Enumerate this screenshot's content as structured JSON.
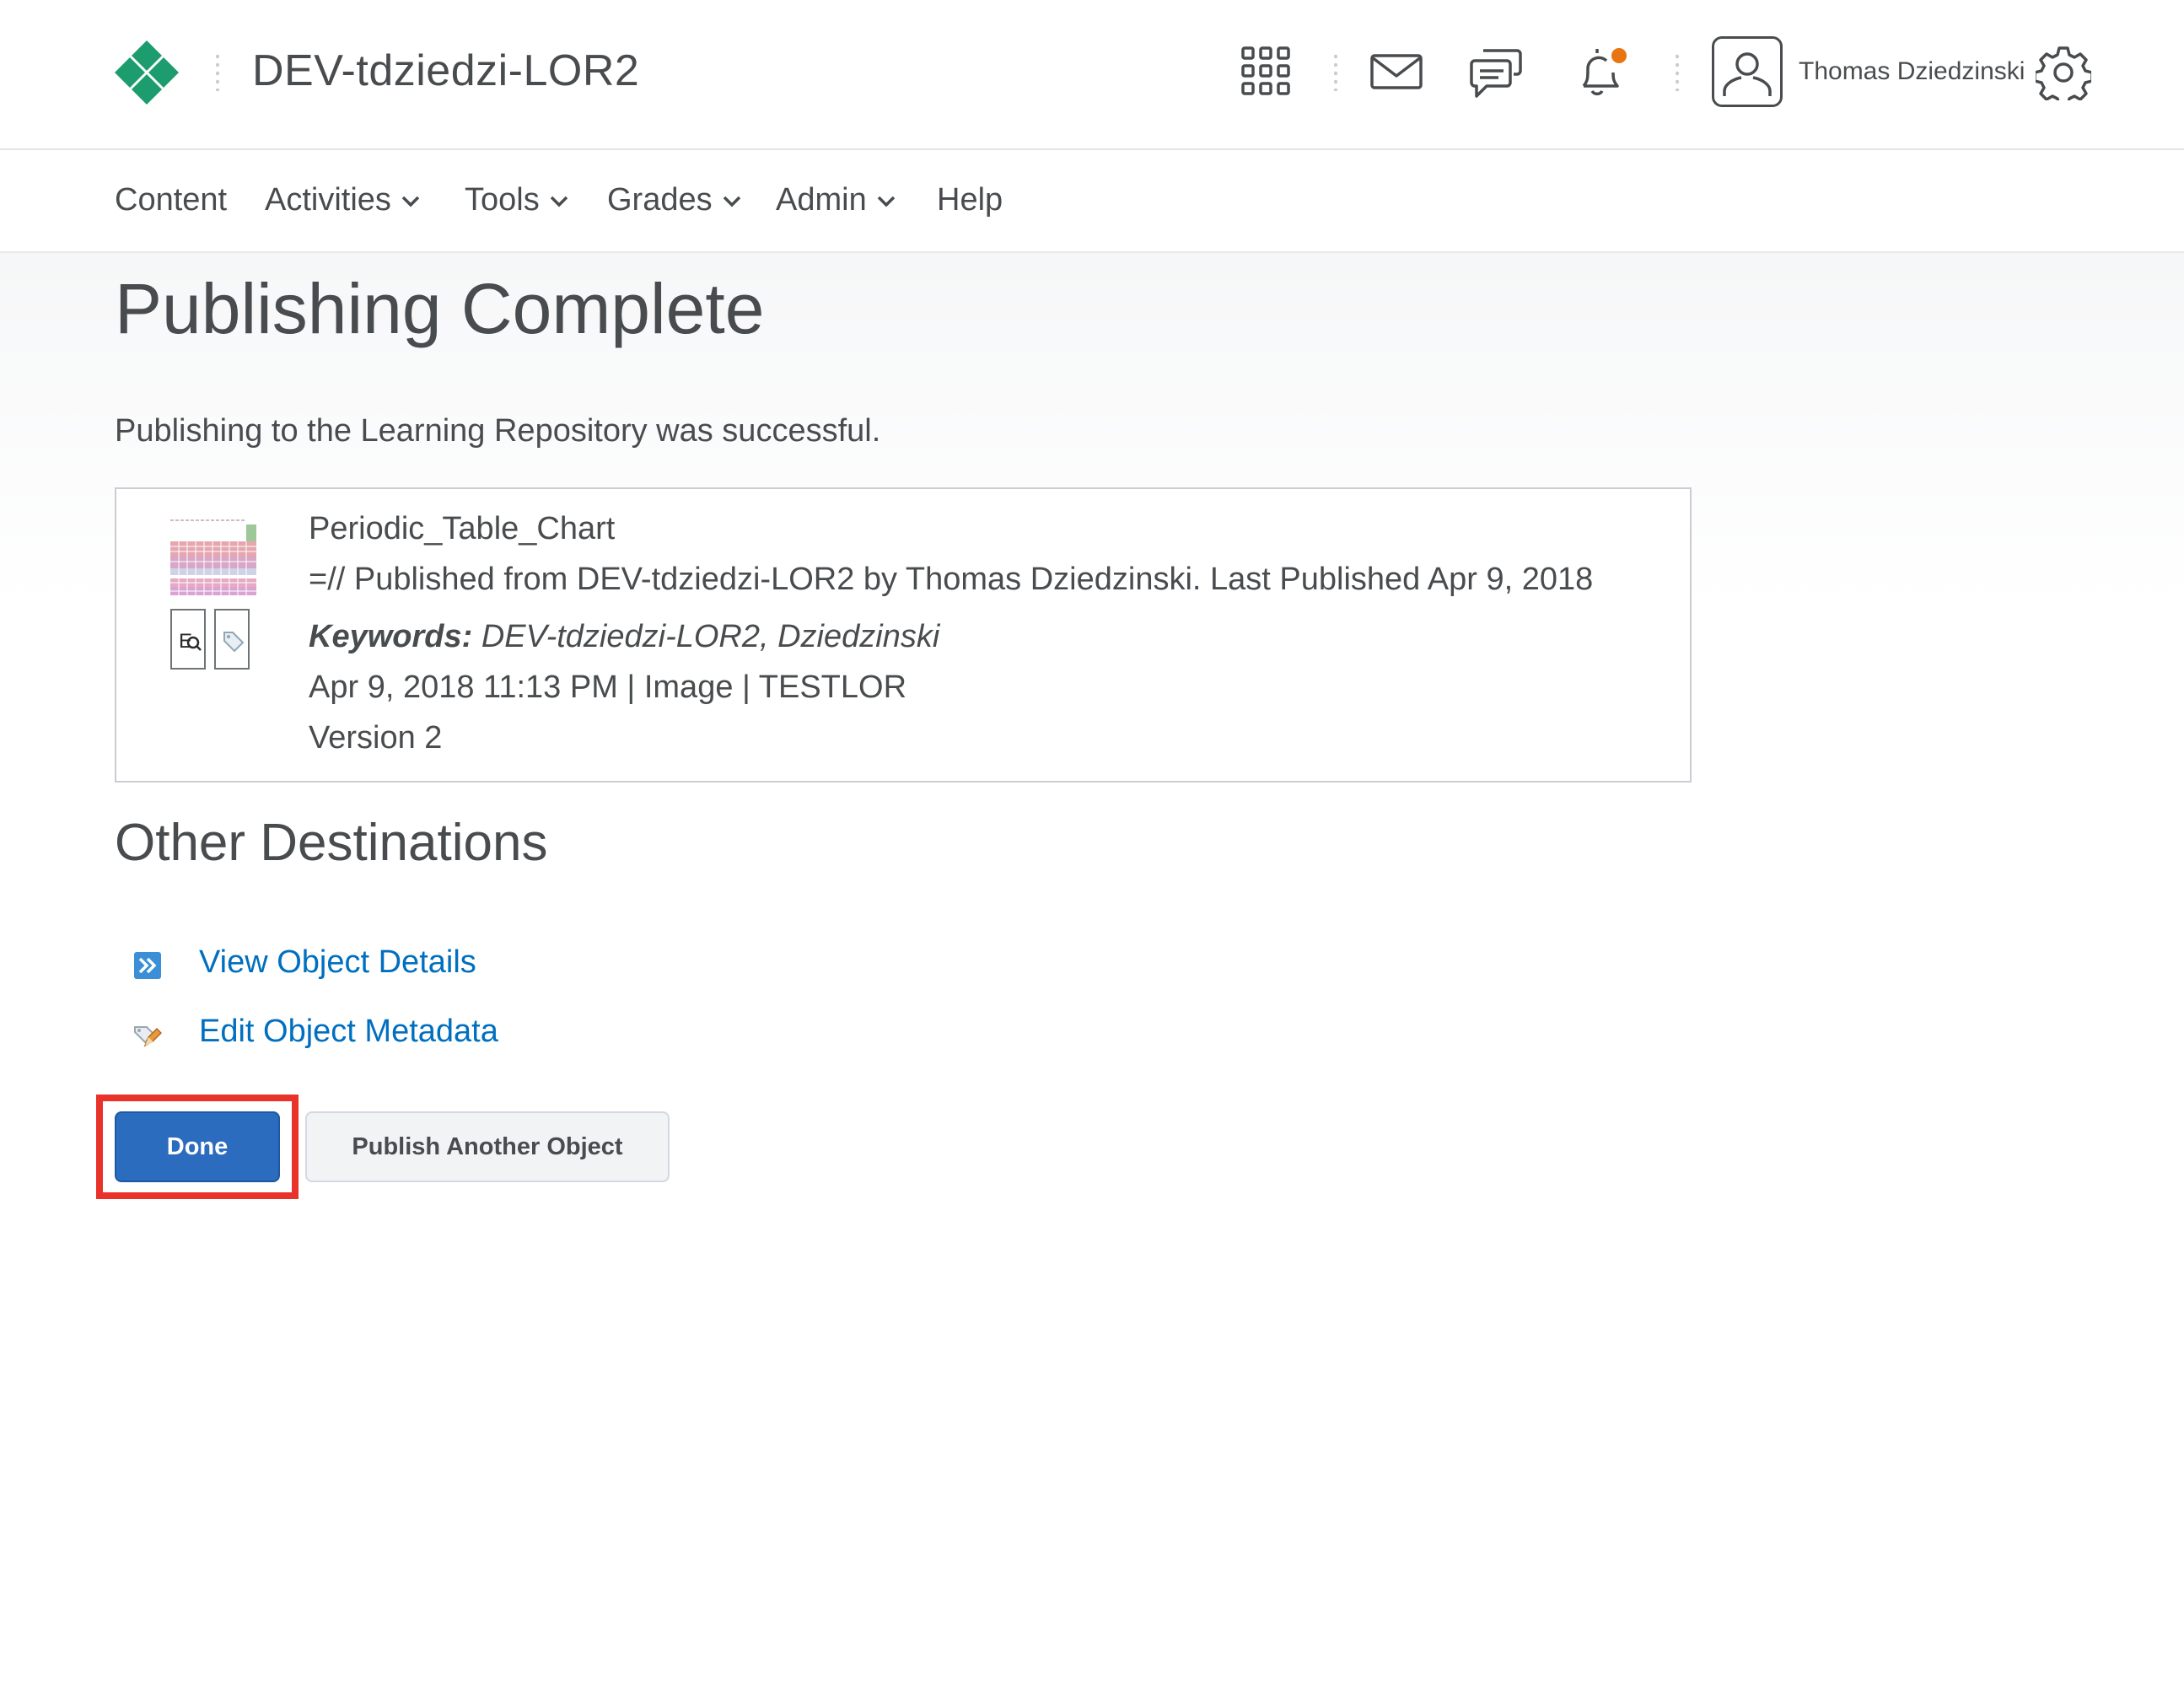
{
  "header": {
    "org_title": "DEV-tdziedzi-LOR2",
    "user_name": "Thomas Dziedzinski",
    "has_notification": true
  },
  "nav": {
    "items": [
      {
        "label": "Content",
        "dropdown": false
      },
      {
        "label": "Activities",
        "dropdown": true
      },
      {
        "label": "Tools",
        "dropdown": true
      },
      {
        "label": "Grades",
        "dropdown": true
      },
      {
        "label": "Admin",
        "dropdown": true
      },
      {
        "label": "Help",
        "dropdown": false
      }
    ]
  },
  "page": {
    "title": "Publishing Complete",
    "message": "Publishing to the Learning Repository was successful."
  },
  "result": {
    "object_title": "Periodic_Table_Chart",
    "description": "=// Published from DEV-tdziedzi-LOR2 by Thomas Dziedzinski. Last Published Apr 9, 2018",
    "keywords_label": "Keywords:",
    "keywords": "DEV-tdziedzi-LOR2, Dziedzinski",
    "meta": "Apr 9, 2018 11:13 PM | Image | TESTLOR",
    "version": "Version 2"
  },
  "destinations": {
    "title": "Other Destinations",
    "links": [
      {
        "label": "View Object Details",
        "icon": "view-details-icon"
      },
      {
        "label": "Edit Object Metadata",
        "icon": "edit-metadata-icon"
      }
    ]
  },
  "actions": {
    "done_label": "Done",
    "publish_another_label": "Publish Another Object"
  },
  "colors": {
    "brand_green": "#1d9c6e",
    "link_blue": "#006fbf",
    "primary_button": "#2b6cbf",
    "highlight_red": "#e8322a",
    "notification_dot": "#e87511"
  }
}
